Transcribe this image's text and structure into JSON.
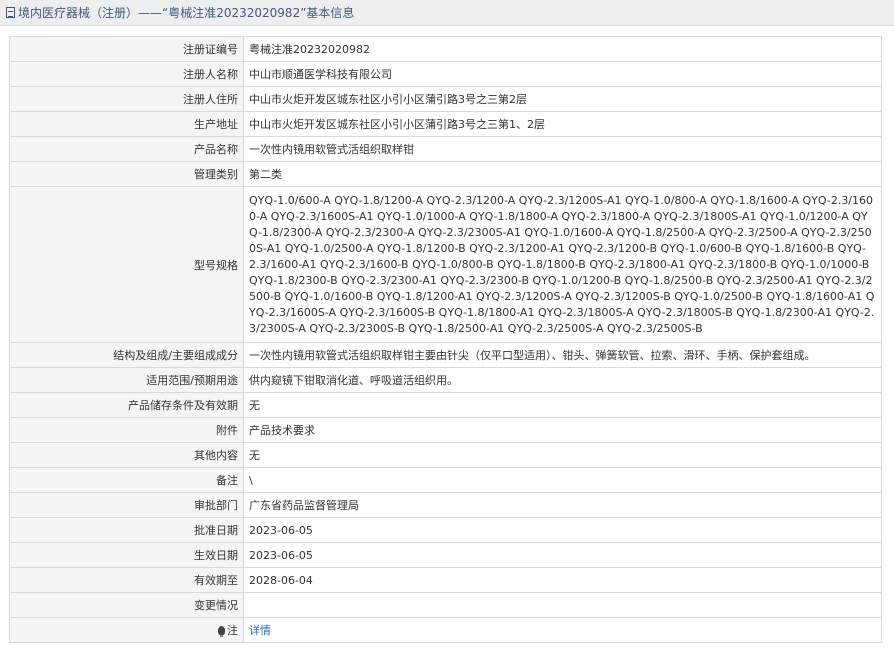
{
  "header": {
    "icon": "document-icon",
    "title": "境内医疗器械（注册）——“粤械注准20232020982”基本信息"
  },
  "rows": [
    {
      "label": "注册证编号",
      "value": "粤械注准20232020982"
    },
    {
      "label": "注册人名称",
      "value": "中山市顺通医学科技有限公司"
    },
    {
      "label": "注册人住所",
      "value": "中山市火炬开发区城东社区小引小区蒲引路3号之三第2层"
    },
    {
      "label": "生产地址",
      "value": "中山市火炬开发区城东社区小引小区蒲引路3号之三第1、2层"
    },
    {
      "label": "产品名称",
      "value": "一次性内镜用软管式活组织取样钳"
    },
    {
      "label": "管理类别",
      "value": "第二类"
    },
    {
      "label": "型号规格",
      "value": "QYQ-1.0/600-A QYQ-1.8/1200-A QYQ-2.3/1200-A QYQ-2.3/1200S-A1 QYQ-1.0/800-A QYQ-1.8/1600-A QYQ-2.3/1600-A QYQ-2.3/1600S-A1 QYQ-1.0/1000-A QYQ-1.8/1800-A QYQ-2.3/1800-A QYQ-2.3/1800S-A1 QYQ-1.0/1200-A QYQ-1.8/2300-A QYQ-2.3/2300-A QYQ-2.3/2300S-A1 QYQ-1.0/1600-A QYQ-1.8/2500-A QYQ-2.3/2500-A QYQ-2.3/2500S-A1 QYQ-1.0/2500-A QYQ-1.8/1200-B QYQ-2.3/1200-A1 QYQ-2.3/1200-B QYQ-1.0/600-B QYQ-1.8/1600-B QYQ-2.3/1600-A1 QYQ-2.3/1600-B QYQ-1.0/800-B QYQ-1.8/1800-B QYQ-2.3/1800-A1 QYQ-2.3/1800-B QYQ-1.0/1000-B QYQ-1.8/2300-B QYQ-2.3/2300-A1 QYQ-2.3/2300-B QYQ-1.0/1200-B QYQ-1.8/2500-B QYQ-2.3/2500-A1 QYQ-2.3/2500-B QYQ-1.0/1600-B QYQ-1.8/1200-A1 QYQ-2.3/1200S-A QYQ-2.3/1200S-B QYQ-1.0/2500-B QYQ-1.8/1600-A1 QYQ-2.3/1600S-A QYQ-2.3/1600S-B QYQ-1.8/1800-A1 QYQ-2.3/1800S-A QYQ-2.3/1800S-B QYQ-1.8/2300-A1 QYQ-2.3/2300S-A QYQ-2.3/2300S-B QYQ-1.8/2500-A1 QYQ-2.3/2500S-A QYQ-2.3/2500S-B"
    },
    {
      "label": "结构及组成/主要组成成分",
      "value": "一次性内镜用软管式活组织取样钳主要由针尖（仅平口型适用）、钳头、弹簧软管、拉索、滑环、手柄、保护套组成。"
    },
    {
      "label": "适用范围/预期用途",
      "value": "供内窥镜下钳取消化道、呼吸道活组织用。"
    },
    {
      "label": "产品储存条件及有效期",
      "value": "无"
    },
    {
      "label": "附件",
      "value": "产品技术要求"
    },
    {
      "label": "其他内容",
      "value": "无"
    },
    {
      "label": "备注",
      "value": "\\"
    },
    {
      "label": "审批部门",
      "value": "广东省药品监督管理局"
    },
    {
      "label": "批准日期",
      "value": "2023-06-05"
    },
    {
      "label": "生效日期",
      "value": "2023-06-05"
    },
    {
      "label": "有效期至",
      "value": "2028-06-04"
    },
    {
      "label": "变更情况",
      "value": ""
    }
  ],
  "note": {
    "icon": "lightbulb-icon",
    "label": "注",
    "link_text": "详情",
    "link_color": "#2a6cbf"
  }
}
